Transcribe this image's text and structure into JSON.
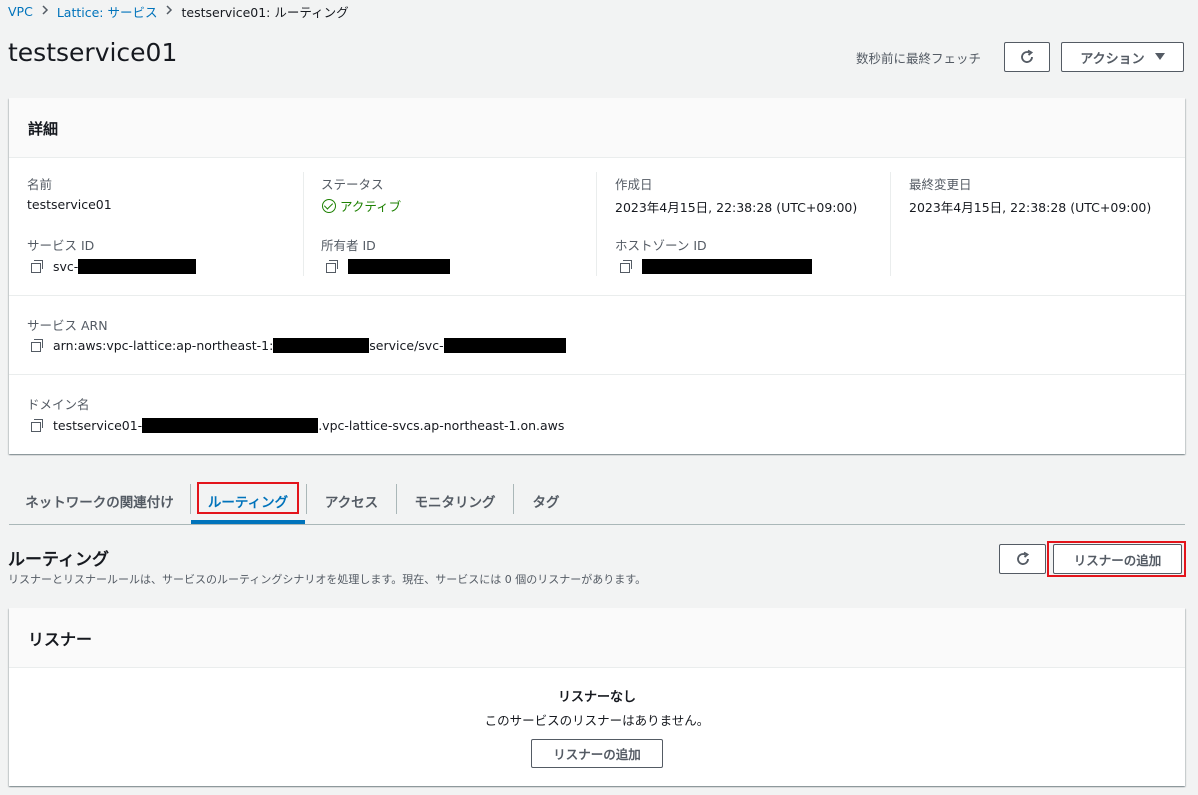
{
  "breadcrumb": {
    "items": [
      "VPC",
      "Lattice: サービス"
    ],
    "current": "testservice01: ルーティング"
  },
  "header": {
    "title": "testservice01",
    "fetch_status": "数秒前に最終フェッチ",
    "action_label": "アクション"
  },
  "details": {
    "title": "詳細",
    "name_label": "名前",
    "name_value": "testservice01",
    "status_label": "ステータス",
    "status_value": "アクティブ",
    "created_label": "作成日",
    "created_value": "2023年4月15日, 22:38:28 (UTC+09:00)",
    "modified_label": "最終変更日",
    "modified_value": "2023年4月15日, 22:38:28 (UTC+09:00)",
    "service_id_label": "サービス ID",
    "service_id_prefix": "svc-",
    "owner_id_label": "所有者 ID",
    "hosted_zone_label": "ホストゾーン ID",
    "arn_label": "サービス ARN",
    "arn_prefix": "arn:aws:vpc-lattice:ap-northeast-1:",
    "arn_middle": "service/svc-",
    "domain_label": "ドメイン名",
    "domain_prefix": "testservice01-",
    "domain_suffix": ".vpc-lattice-svcs.ap-northeast-1.on.aws"
  },
  "tabs": [
    {
      "label": "ネットワークの関連付け"
    },
    {
      "label": "ルーティング"
    },
    {
      "label": "アクセス"
    },
    {
      "label": "モニタリング"
    },
    {
      "label": "タグ"
    }
  ],
  "routing": {
    "title": "ルーティング",
    "description": "リスナーとリスナールールは、サービスのルーティングシナリオを処理します。現在、サービスには 0 個のリスナーがあります。",
    "add_listener_label": "リスナーの追加"
  },
  "listeners": {
    "title": "リスナー",
    "empty_title": "リスナーなし",
    "empty_description": "このサービスのリスナーはありません。",
    "add_listener_label": "リスナーの追加"
  },
  "colors": {
    "link": "#0073bb",
    "success": "#1d8102",
    "highlight": "#e3141b"
  }
}
